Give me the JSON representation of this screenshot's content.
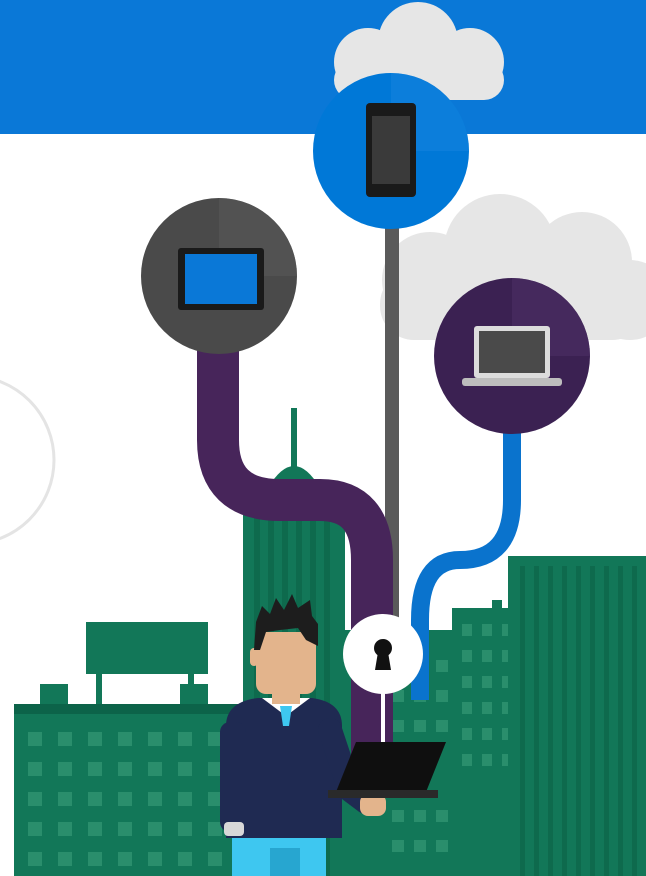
{
  "illustration": {
    "subject": "person-with-laptop-connected-to-devices",
    "palette": {
      "header_blue": "#0a78d7",
      "device_blue": "#0078d7",
      "device_dark": "#4a4a4a",
      "device_purple": "#3b2152",
      "cable_purple": "#47255a",
      "cable_gray": "#5a5a5a",
      "cable_blue": "#0a73cd",
      "building_green": "#127758",
      "building_green_dark": "#0c6349",
      "building_window": "#2a8e6c",
      "cloud": "#e6e6e6",
      "lock_circle": "#ffffff",
      "skin": "#e3b48c",
      "hair": "#1d1d1d",
      "sweater": "#1f2a52",
      "pants": "#3ec7f0"
    },
    "devices": [
      {
        "icon": "smartphone-icon",
        "circle_color": "#0078d7"
      },
      {
        "icon": "tablet-icon",
        "circle_color": "#4a4a4a"
      },
      {
        "icon": "laptop-icon",
        "circle_color": "#3b2152"
      }
    ],
    "lock_icon": "keyhole-lock-icon"
  }
}
